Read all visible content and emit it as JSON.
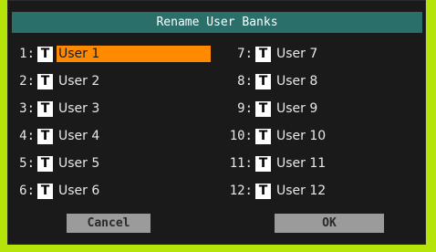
{
  "dialog": {
    "title": "Rename User Banks",
    "banks": [
      {
        "num": "1:",
        "t": "T",
        "name": "User 1",
        "selected": true
      },
      {
        "num": "2:",
        "t": "T",
        "name": "User 2"
      },
      {
        "num": "3:",
        "t": "T",
        "name": "User 3"
      },
      {
        "num": "4:",
        "t": "T",
        "name": "User 4"
      },
      {
        "num": "5:",
        "t": "T",
        "name": "User 5"
      },
      {
        "num": "6:",
        "t": "T",
        "name": "User 6"
      },
      {
        "num": "7:",
        "t": "T",
        "name": "User 7"
      },
      {
        "num": "8:",
        "t": "T",
        "name": "User 8"
      },
      {
        "num": "9:",
        "t": "T",
        "name": "User 9"
      },
      {
        "num": "10:",
        "t": "T",
        "name": "User 10"
      },
      {
        "num": "11:",
        "t": "T",
        "name": "User 11"
      },
      {
        "num": "12:",
        "t": "T",
        "name": "User 12"
      }
    ],
    "cancel_label": "Cancel",
    "ok_label": "OK"
  },
  "colors": {
    "background": "#b4e40a",
    "dialog": "#1a1a1a",
    "title_bar": "#2a6f6a",
    "selected_field": "#ff8a00",
    "button": "#9b9b9b"
  }
}
